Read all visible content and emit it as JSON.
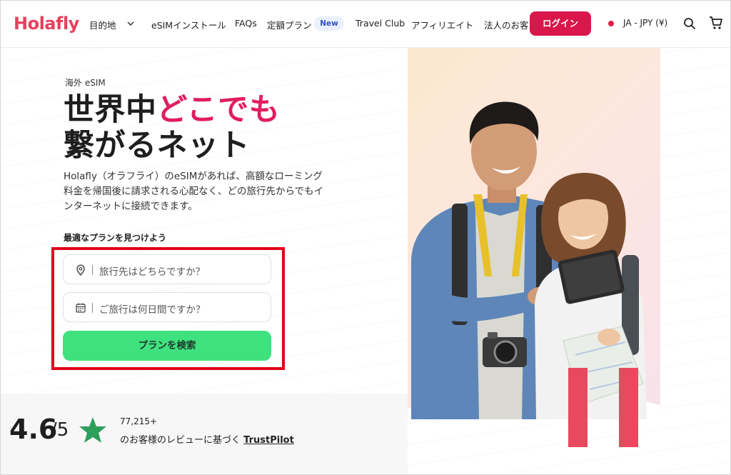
{
  "brand": {
    "logo_text": "Holafly",
    "accent_color": "#e11d5f",
    "cta_color": "#3fe17e"
  },
  "nav": {
    "items": [
      {
        "label": "目的地"
      },
      {
        "label": "eSIMインストール"
      },
      {
        "label": "FAQs"
      },
      {
        "label": "定額プラン"
      },
      {
        "label": "Travel Club"
      },
      {
        "label": "アフィリエイト"
      },
      {
        "label": "法人のお客"
      }
    ],
    "new_badge": "New",
    "login_label": "ログイン",
    "locale": "JA - JPY (¥)"
  },
  "hero": {
    "eyebrow": "海外 eSIM",
    "headline_line1_a": "世界中",
    "headline_line1_b": "どこでも",
    "headline_line2": "繋がるネット",
    "description": "Holafly（オラフライ）のeSIMがあれば、高額なローミング料金を帰国後に請求される心配なく、どの旅行先からでもインターネットに接続できます。"
  },
  "finder": {
    "label": "最適なプランを見つけよう",
    "destination_placeholder": "旅行先はどちらですか？",
    "duration_placeholder": "ご旅行は何日間ですか？",
    "search_label": "プランを検索"
  },
  "rating": {
    "score": "4.6",
    "out_of": "/5",
    "count": "77,215+",
    "text": "のお客様のレビューに基づく",
    "source": "TrustPilot",
    "star_color": "#2e9e5b"
  }
}
